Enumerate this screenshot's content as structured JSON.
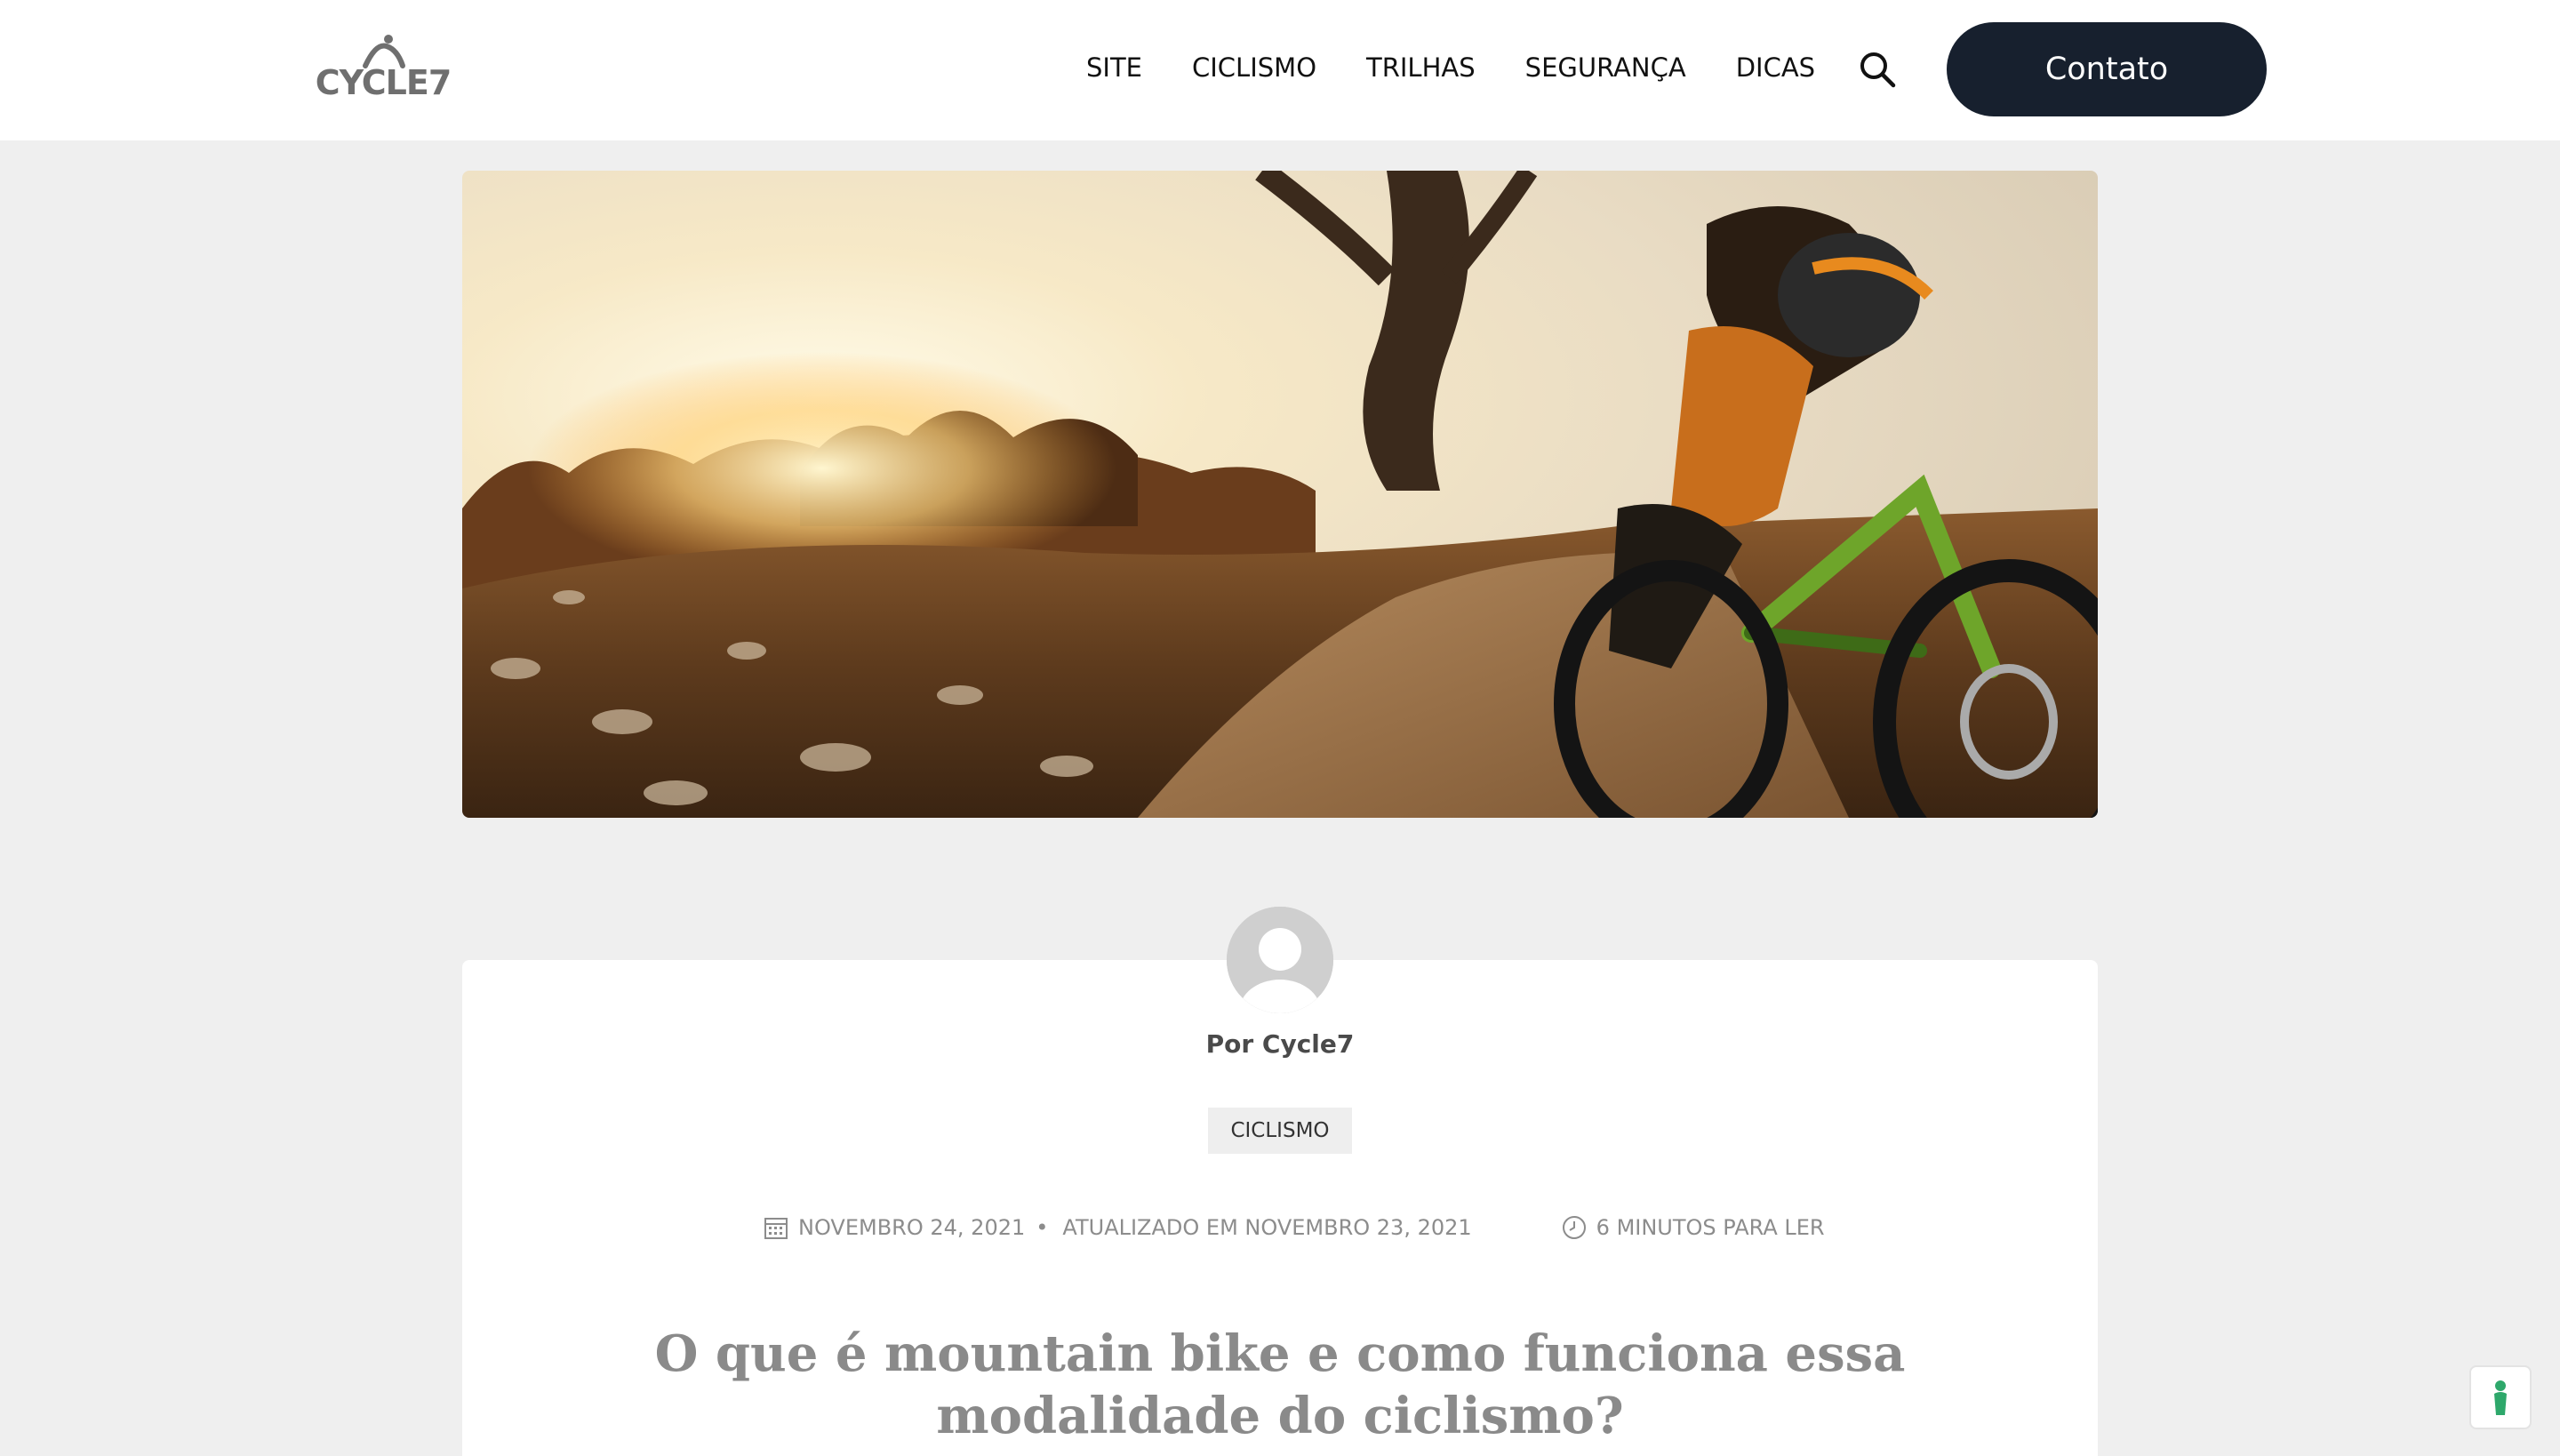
{
  "header": {
    "logo_text": "CYCLE7",
    "nav": [
      "SITE",
      "CICLISMO",
      "TRILHAS",
      "SEGURANÇA",
      "DICAS"
    ],
    "contact_label": "Contato"
  },
  "article": {
    "author": "Por Cycle7",
    "category": "CICLISMO",
    "published": "NOVEMBRO 24, 2021",
    "updated": "ATUALIZADO EM NOVEMBRO 23, 2021",
    "read_time": "6 MINUTOS PARA LER",
    "title": "O que é mountain bike e como funciona essa modalidade do ciclismo?"
  },
  "colors": {
    "primary": "#17202e",
    "background": "#efefef",
    "card": "#ffffff",
    "muted": "#8c8c8c",
    "accent_green": "#2ea86b"
  }
}
